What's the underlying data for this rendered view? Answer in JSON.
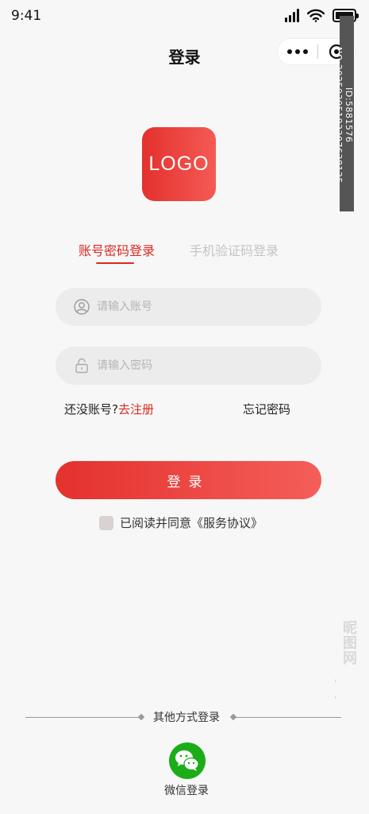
{
  "status_bar": {
    "time": "9:41"
  },
  "nav": {
    "title": "登录"
  },
  "logo": {
    "text": "LOGO"
  },
  "tabs": [
    {
      "label": "账号密码登录",
      "active": true
    },
    {
      "label": "手机验证码登录",
      "active": false
    }
  ],
  "form": {
    "account_placeholder": "请输入账号",
    "password_placeholder": "请输入密码",
    "register_prefix": "还没账号?",
    "register_link": "去注册",
    "forgot_password": "忘记密码",
    "login_button": "登录",
    "agreement": "已阅读并同意《服务协议》"
  },
  "other_login": {
    "title": "其他方式登录",
    "wechat_label": "微信登录"
  },
  "watermark": {
    "id_text": "ID:5881576 NO:20250305183307638125",
    "site_text": "昵图网 www.nipic.com"
  },
  "colors": {
    "accent": "#d92a22",
    "gradient_start": "#e4312d",
    "gradient_end": "#f45e59",
    "wechat_green": "#1aad19"
  },
  "icons": [
    "signal-icon",
    "wifi-icon",
    "battery-icon",
    "more-icon",
    "target-icon",
    "user-icon",
    "lock-icon",
    "wechat-icon"
  ]
}
